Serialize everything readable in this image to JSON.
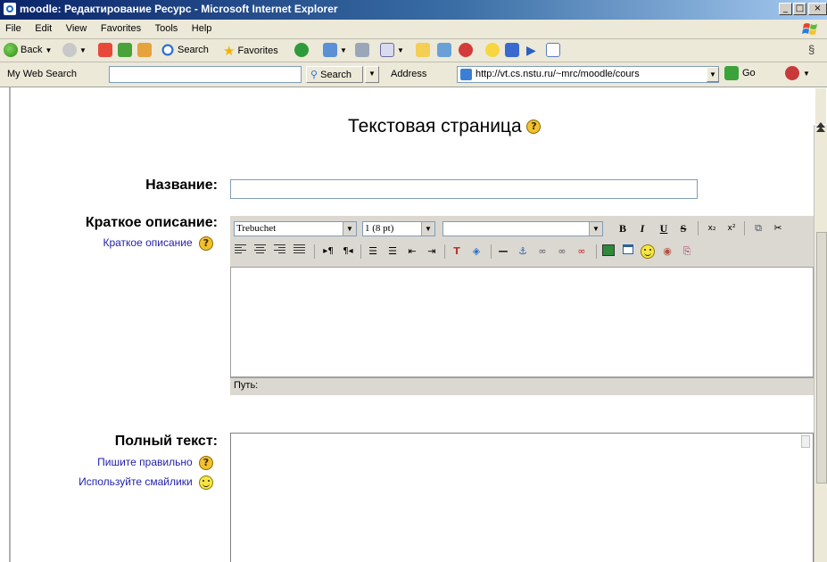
{
  "window": {
    "title": "moodle: Редактирование Ресурс - Microsoft Internet Explorer",
    "controls": [
      "_",
      "□",
      "×"
    ]
  },
  "menu": {
    "items": [
      "File",
      "Edit",
      "View",
      "Favorites",
      "Tools",
      "Help"
    ]
  },
  "toolbar": {
    "back_label": "Back",
    "search_label": "Search",
    "favorites_label": "Favorites"
  },
  "addressbar": {
    "my_web_search_label": "My Web Search",
    "search_button_label": "Search",
    "address_label": "Address",
    "url": "http://vt.cs.nstu.ru/~mrc/moodle/cours",
    "go_label": "Go"
  },
  "page": {
    "title": "Текстовая страница",
    "name_label": "Название:",
    "name_value": "",
    "summary_label": "Краткое описание:",
    "summary_help_link": "Краткое описание",
    "fulltext_label": "Полный текст:",
    "fulltext_help_link": "Пишите правильно",
    "fulltext_smiley_link": "Используйте смайлики"
  },
  "editor": {
    "font_family": "Trebuchet",
    "font_size": "1 (8 pt)",
    "style_value": "",
    "path_label": "Путь:",
    "format_buttons": [
      "B",
      "I",
      "U",
      "S"
    ]
  }
}
